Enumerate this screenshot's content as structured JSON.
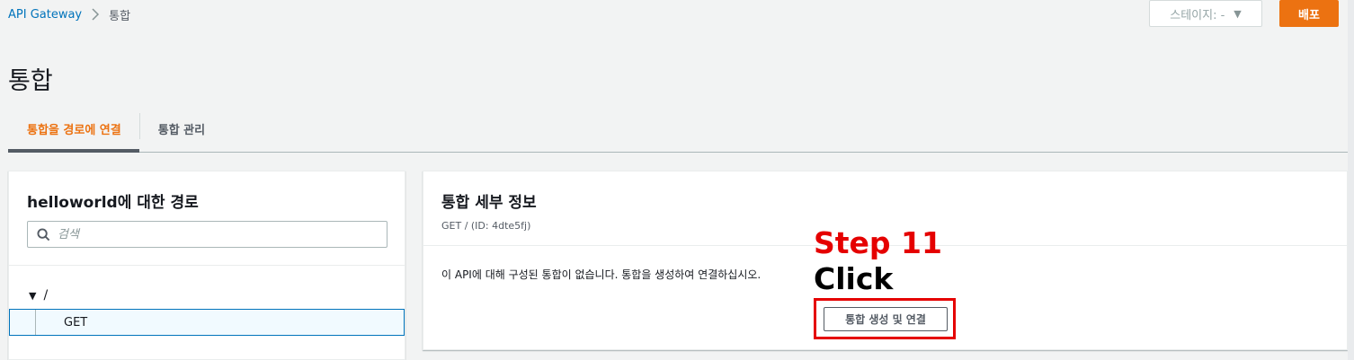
{
  "breadcrumb": {
    "root": "API Gateway",
    "current": "통합"
  },
  "header": {
    "stage_select": "스테이지: -",
    "deploy_label": "배포"
  },
  "page": {
    "title": "통합"
  },
  "tabs": [
    {
      "label": "통합을 경로에 연결",
      "active": true
    },
    {
      "label": "통합 관리",
      "active": false
    }
  ],
  "routes_panel": {
    "title": "helloworld에 대한 경로",
    "search_placeholder": "검색",
    "root_path": "/",
    "methods": [
      "GET"
    ]
  },
  "details_panel": {
    "title": "통합 세부 정보",
    "route_info": "GET / (ID: 4dte5fj)",
    "empty_message": "이 API에 대해 구성된 통합이 없습니다. 통합을 생성하여 연결하십시오.",
    "create_button": "통합 생성 및 연결"
  },
  "annotation": {
    "step": "Step 11",
    "action": "Click",
    "step_color": "#e50000",
    "highlight_color": "#e50000"
  },
  "colors": {
    "accent": "#ec7211",
    "link": "#0073bb",
    "background": "#f2f3f3"
  }
}
